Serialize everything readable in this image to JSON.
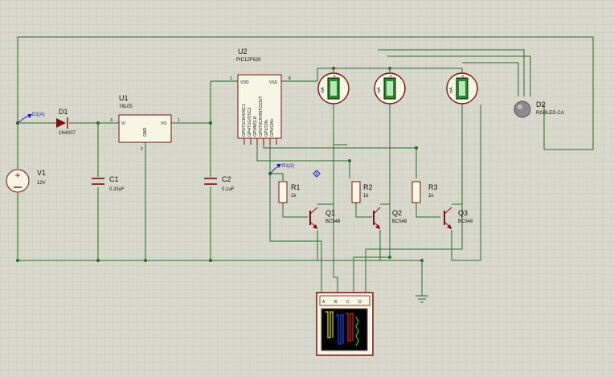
{
  "components": {
    "V1": {
      "ref": "V1",
      "value": "12V"
    },
    "D1": {
      "ref": "D1",
      "value": "1N4007",
      "probe": "D1(A)"
    },
    "U1": {
      "ref": "U1",
      "value": "78L05",
      "pin_vi": "VI",
      "pin_vo": "VO",
      "pin_gnd": "GND",
      "pin_in": "3",
      "pin_out": "1",
      "pin_g": "2"
    },
    "C1": {
      "ref": "C1",
      "value": "0.33uF"
    },
    "C2": {
      "ref": "C2",
      "value": "0.1uF"
    },
    "U2": {
      "ref": "U2",
      "value": "PIC12F629",
      "pin_vdd": "VDD",
      "pin_vss": "VSS",
      "pin1": "1",
      "pin8": "8",
      "pins": [
        "GP5/T1CKI/OSC1",
        "GP4/T1G/OSC2",
        "GP3/MCLR",
        "GP2/T0CKI/INT/COUT",
        "GP1/CIN-",
        "GP0/CIN+"
      ]
    },
    "R1": {
      "ref": "R1",
      "value": "1k",
      "probe": "R1(2)"
    },
    "R2": {
      "ref": "R2",
      "value": "1k"
    },
    "R3": {
      "ref": "R3",
      "value": "1k"
    },
    "Q1": {
      "ref": "Q1",
      "value": "BC548"
    },
    "Q2": {
      "ref": "Q2",
      "value": "BC548"
    },
    "Q3": {
      "ref": "Q3",
      "value": "BC548"
    },
    "D2": {
      "ref": "D2",
      "value": "RGBLED-CA"
    },
    "meter": {
      "unit": "mA"
    },
    "scope": {
      "channels": [
        "A",
        "B",
        "C",
        "D"
      ]
    }
  },
  "colors": {
    "background": "#d8d8cc",
    "grid": "#c4c4b6",
    "wire": "#2a6a2a",
    "component_outline": "#7a1010",
    "component_fill": "#f6f6e4",
    "probe": "#1020c0",
    "scope_body": "#7a1010",
    "led": "#8a8a8a",
    "meter_display": "#2a8a2a"
  }
}
